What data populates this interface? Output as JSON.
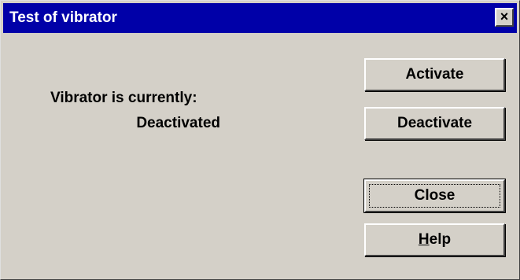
{
  "window": {
    "title": "Test of vibrator",
    "close_glyph": "×"
  },
  "status": {
    "caption": "Vibrator is currently:",
    "value": "Deactivated"
  },
  "buttons": {
    "activate": "Activate",
    "deactivate": "Deactivate",
    "close": "Close",
    "help_mnemonic": "H",
    "help_rest": "elp"
  },
  "colors": {
    "titlebar": "#0000a8",
    "face": "#d4d0c8",
    "title_text": "#ffffff"
  },
  "focused_button": "close"
}
